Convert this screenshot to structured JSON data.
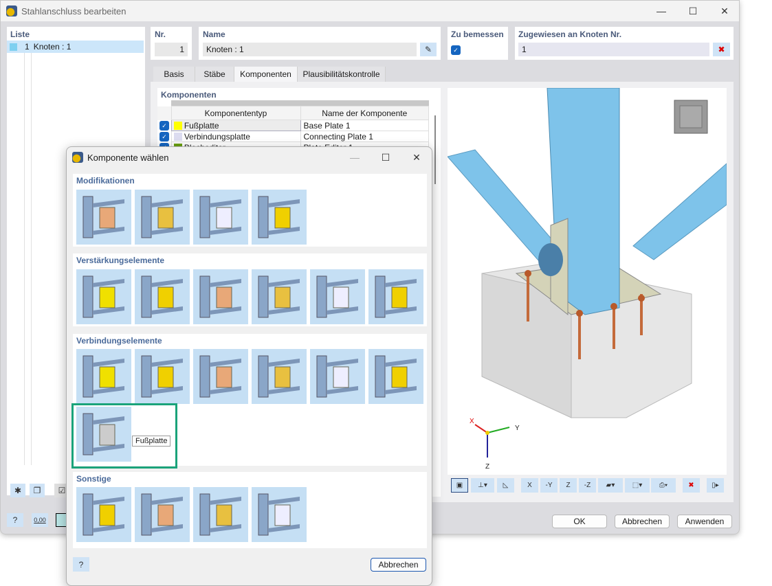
{
  "window": {
    "title": "Stahlanschluss bearbeiten",
    "minimize": "—",
    "maximize": "☐",
    "close": "✕"
  },
  "list": {
    "header": "Liste",
    "items": [
      {
        "nr": "1",
        "label": "Knoten : 1",
        "color": "#7fd0f0"
      }
    ]
  },
  "nr": {
    "label": "Nr.",
    "value": "1"
  },
  "name": {
    "label": "Name",
    "value": "Knoten : 1"
  },
  "design": {
    "label": "Zu bemessen",
    "checked": true
  },
  "assigned": {
    "label": "Zugewiesen an Knoten Nr.",
    "value": "1"
  },
  "tabs": [
    {
      "label": "Basis"
    },
    {
      "label": "Stäbe"
    },
    {
      "label": "Komponenten",
      "active": true
    },
    {
      "label": "Plausibilitätskontrolle"
    }
  ],
  "components": {
    "title": "Komponenten",
    "columns": [
      "Komponententyp",
      "Name der Komponente"
    ],
    "rows": [
      {
        "checked": true,
        "color": "#ffff00",
        "type": "Fußplatte",
        "name": "Base Plate 1"
      },
      {
        "checked": true,
        "color": "#dcdcf0",
        "type": "Verbindungsplatte",
        "name": "Connecting Plate 1"
      },
      {
        "checked": true,
        "color": "#6aa010",
        "type": "Blecheditor",
        "name": "Plate Editor 1"
      }
    ]
  },
  "view_toolbar": {
    "x": "X",
    "neg_y": "-Y",
    "z": "Z",
    "neg_z": "-Z"
  },
  "axes": {
    "x": "X",
    "y": "Y",
    "z": "Z"
  },
  "footer": {
    "ok": "OK",
    "cancel": "Abbrechen",
    "apply": "Anwenden",
    "units": "0,00"
  },
  "dialog": {
    "title": "Komponente wählen",
    "cancel": "Abbrechen",
    "sections": [
      {
        "title": "Modifikationen",
        "count": 4
      },
      {
        "title": "Verstärkungselemente",
        "count": 6
      },
      {
        "title": "Verbindungselemente",
        "count": 7
      },
      {
        "title": "Sonstige",
        "count": 4
      }
    ],
    "selected": "Fußplatte",
    "tooltip": "Fußplatte",
    "highlight_color": "#1aa37a"
  }
}
